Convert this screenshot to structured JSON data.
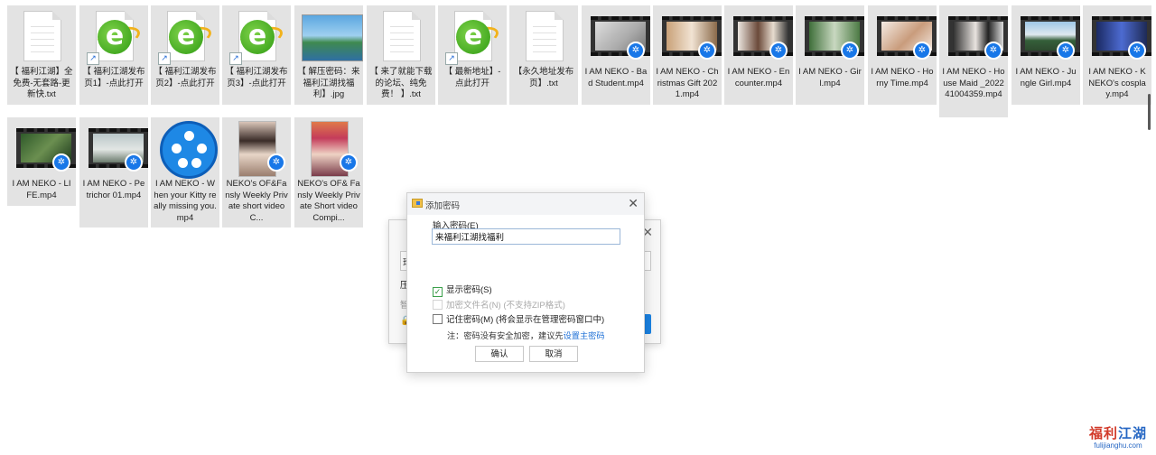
{
  "files": [
    {
      "label": "【 福利江湖】全免费-无套路-更新快.txt",
      "type": "txt"
    },
    {
      "label": "【 福利江湖发布页1】-点此打开",
      "type": "ie"
    },
    {
      "label": "【 福利江湖发布页2】-点此打开",
      "type": "ie"
    },
    {
      "label": "【 福利江湖发布页3】-点此打开",
      "type": "ie"
    },
    {
      "label": "【 解压密码：来福利江湖找福利】.jpg",
      "type": "jpg"
    },
    {
      "label": "【 来了就能下载的论坛、纯免费！ 】.txt",
      "type": "txt"
    },
    {
      "label": "【 最新地址】-点此打开",
      "type": "ie"
    },
    {
      "label": "【永久地址发布页】.txt",
      "type": "txt"
    },
    {
      "label": "I AM NEKO - Bad Student.mp4",
      "type": "video"
    },
    {
      "label": "I AM NEKO - Christmas Gift 2021.mp4",
      "type": "video"
    },
    {
      "label": "I AM NEKO - Encounter.mp4",
      "type": "video"
    },
    {
      "label": "I AM NEKO - Girl.mp4",
      "type": "video"
    },
    {
      "label": "I AM NEKO - Horny Time.mp4",
      "type": "video"
    },
    {
      "label": "I AM NEKO - House Maid _202241004359.mp4",
      "type": "video"
    },
    {
      "label": "I AM NEKO - Jungle Girl.mp4",
      "type": "video"
    },
    {
      "label": "I AM NEKO - K NEKO's cosplay.mp4",
      "type": "video"
    },
    {
      "label": "I AM NEKO - LIFE.mp4",
      "type": "video"
    },
    {
      "label": "I AM NEKO - Petrichor 01.mp4",
      "type": "video"
    },
    {
      "label": "I AM NEKO - When your Kitty really missing you.mp4",
      "type": "player"
    },
    {
      "label": "NEKO's OF&Fansly Weekly Private short video C...",
      "type": "portrait"
    },
    {
      "label": "NEKO's OF& Fansly Weekly Private Short video Compi...",
      "type": "portrait"
    }
  ],
  "dialog": {
    "title": "添加密码",
    "password_label": "输入密码(E)",
    "password_value": "来福利江湖找福利",
    "show_password": "显示密码(S)",
    "encrypt_names": "加密文件名(N) (不支持ZIP格式)",
    "remember_password": "记住密码(M) (将会显示在管理密码窗口中)",
    "note_prefix": "注：密码没有安全加密，建议先",
    "note_link": "设置主密码",
    "ok_label": "确认",
    "cancel_label": "取消"
  },
  "background_dialog": {
    "text_line1": "珍",
    "text_line2": "压",
    "text_line3": "智"
  },
  "watermark": {
    "main_red": "福利",
    "main_blue": "江湖",
    "sub": "fulijianghu.com"
  },
  "colors": {
    "tile_bg": "#e3e3e3",
    "accent_blue": "#1a82e2",
    "check_green": "#3aa04a",
    "link_blue": "#1d6fd6"
  }
}
